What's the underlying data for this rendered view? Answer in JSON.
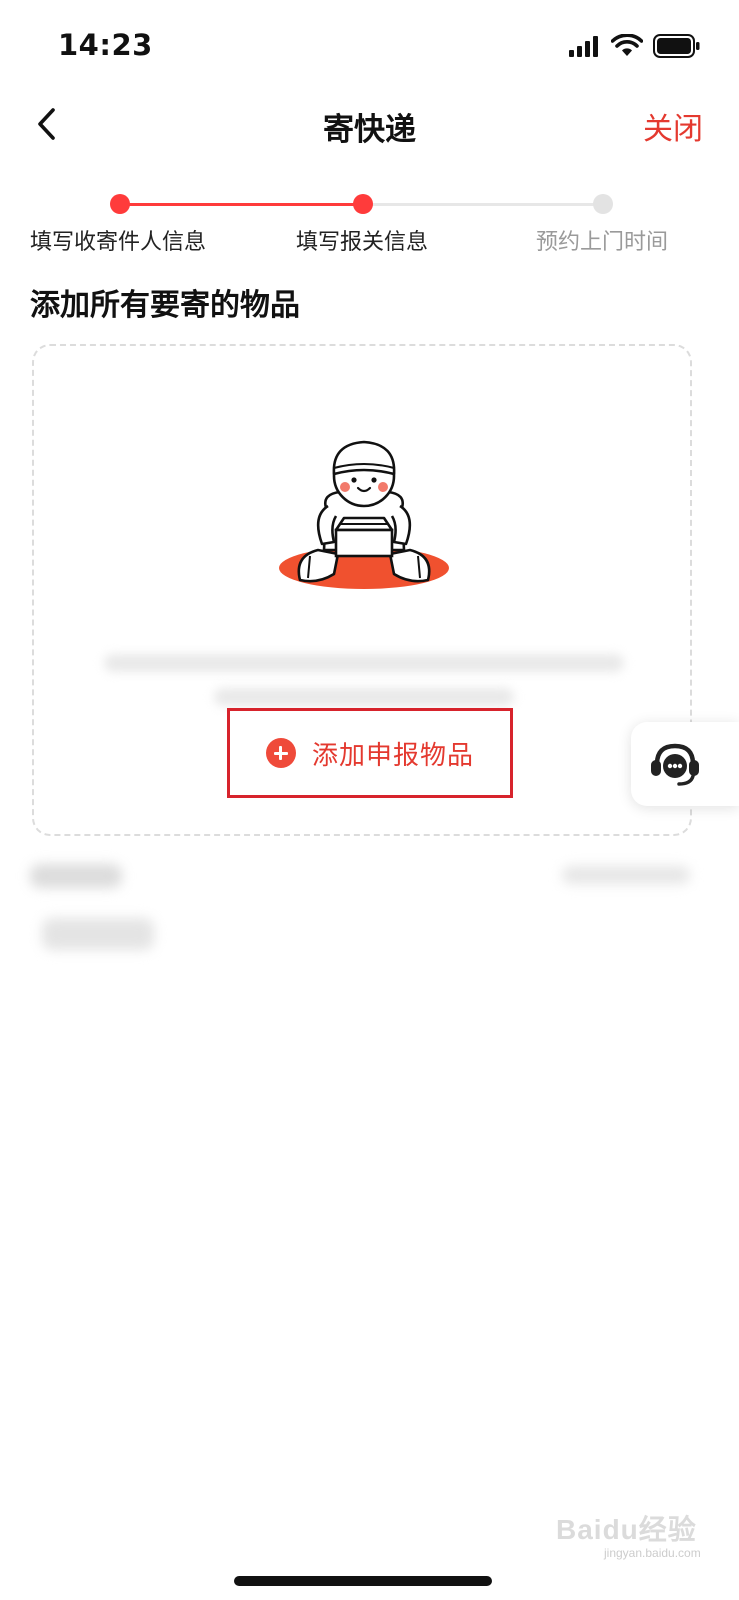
{
  "status_bar": {
    "time": "14:23",
    "icons": [
      "signal-icon",
      "wifi-icon",
      "battery-icon"
    ]
  },
  "nav": {
    "title": "寄快递",
    "close_label": "关闭",
    "back_icon": "chevron-left-icon"
  },
  "stepper": {
    "steps": [
      {
        "label": "填写收寄件人信息",
        "state": "done"
      },
      {
        "label": "填写报关信息",
        "state": "current"
      },
      {
        "label": "预约上门时间",
        "state": "pending"
      }
    ]
  },
  "section": {
    "title": "添加所有要寄的物品"
  },
  "item_card": {
    "illustration": "courier-holding-box-illustration",
    "add_button_label": "添加申报物品",
    "add_icon": "plus-circle-icon"
  },
  "support": {
    "icon": "customer-service-headset-icon"
  },
  "watermark": {
    "brand": "Baidu经验",
    "sub": "jingyan.baidu.com"
  },
  "colors": {
    "accent": "#e4392f",
    "step_active": "#ff3b3b",
    "step_inactive": "#e3e3e3",
    "highlight_border": "#d7232c"
  }
}
